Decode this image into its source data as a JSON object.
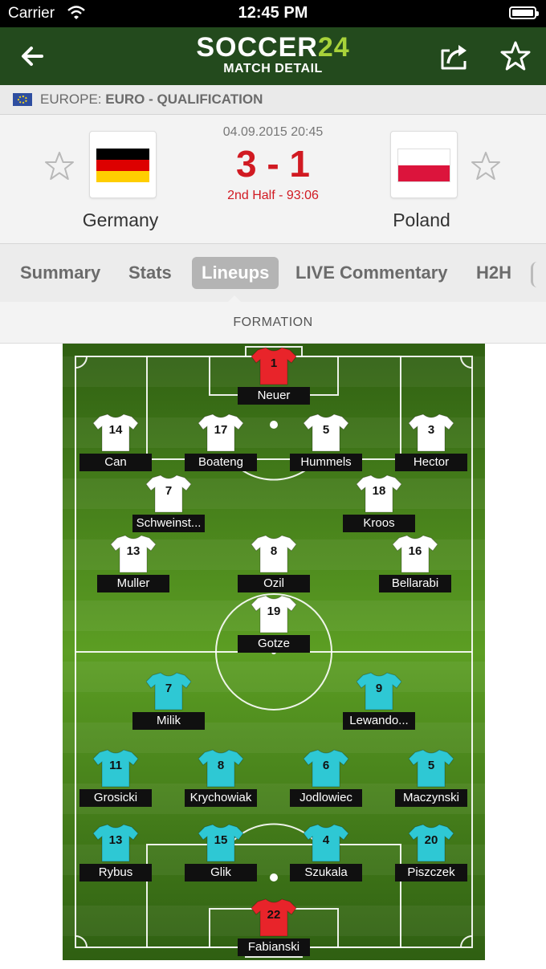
{
  "status_bar": {
    "carrier": "Carrier",
    "time": "12:45 PM"
  },
  "nav": {
    "logo_main": "SOCCER",
    "logo_num": "24",
    "subtitle": "MATCH DETAIL"
  },
  "league": {
    "region": "EUROPE:",
    "competition": "EURO - QUALIFICATION"
  },
  "match": {
    "date": "04.09.2015 20:45",
    "score": "3 - 1",
    "status": "2nd Half - 93:06",
    "home": {
      "name": "Germany",
      "flag_colors": [
        "#000000",
        "#dd0000",
        "#ffce00"
      ]
    },
    "away": {
      "name": "Poland",
      "flag_colors": [
        "#ffffff",
        "#dc143c"
      ]
    }
  },
  "tabs": [
    "Summary",
    "Stats",
    "Lineups",
    "LIVE Commentary",
    "H2H"
  ],
  "active_tab": "Lineups",
  "section_label": "FORMATION",
  "colors": {
    "nav_green": "#234a1d",
    "score_red": "#d11a22",
    "home_shirt": "#ffffff",
    "home_keeper_shirt": "#e8242a",
    "away_shirt": "#2ec8d4",
    "away_keeper_shirt": "#e8242a"
  },
  "lineups": {
    "home": [
      {
        "number": "1",
        "name": "Neuer",
        "goalkeeper": true
      },
      {
        "number": "14",
        "name": "Can"
      },
      {
        "number": "17",
        "name": "Boateng"
      },
      {
        "number": "5",
        "name": "Hummels"
      },
      {
        "number": "3",
        "name": "Hector"
      },
      {
        "number": "7",
        "name": "Schweinst..."
      },
      {
        "number": "18",
        "name": "Kroos"
      },
      {
        "number": "13",
        "name": "Muller"
      },
      {
        "number": "8",
        "name": "Ozil"
      },
      {
        "number": "16",
        "name": "Bellarabi"
      },
      {
        "number": "19",
        "name": "Gotze"
      }
    ],
    "away": [
      {
        "number": "7",
        "name": "Milik"
      },
      {
        "number": "9",
        "name": "Lewando..."
      },
      {
        "number": "11",
        "name": "Grosicki"
      },
      {
        "number": "8",
        "name": "Krychowiak"
      },
      {
        "number": "6",
        "name": "Jodlowiec"
      },
      {
        "number": "5",
        "name": "Maczynski"
      },
      {
        "number": "13",
        "name": "Rybus"
      },
      {
        "number": "15",
        "name": "Glik"
      },
      {
        "number": "4",
        "name": "Szukala"
      },
      {
        "number": "20",
        "name": "Piszczek"
      },
      {
        "number": "22",
        "name": "Fabianski",
        "goalkeeper": true
      }
    ]
  }
}
